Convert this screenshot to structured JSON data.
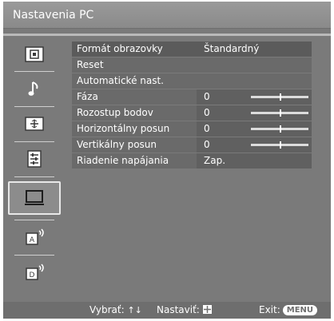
{
  "window": {
    "title": "Nastavenia PC"
  },
  "menu": {
    "rows": [
      {
        "label": "Formát obrazovky",
        "value": "Štandardný"
      },
      {
        "label": "Reset"
      },
      {
        "label": "Automatické nast."
      },
      {
        "label": "Fáza",
        "value": "0",
        "slider_level": 0.5
      },
      {
        "label": "Rozostup bodov",
        "value": "0",
        "slider_level": 0.5
      },
      {
        "label": "Horizontálny posun",
        "value": "0",
        "slider_level": 0.5
      },
      {
        "label": "Vertikálny posun",
        "value": "0",
        "slider_level": 0.5
      },
      {
        "label": "Riadenie napájania",
        "value": "Zap."
      }
    ]
  },
  "sidebar": {
    "items": [
      {
        "icon": "picture-icon"
      },
      {
        "icon": "music-note-icon"
      },
      {
        "icon": "screen-adjust-icon"
      },
      {
        "icon": "settings-list-icon"
      },
      {
        "icon": "pc-monitor-icon",
        "selected": true
      },
      {
        "icon": "input-a-icon"
      },
      {
        "icon": "input-d-icon"
      }
    ]
  },
  "footer": {
    "select_label": "Vybrať:",
    "select_arrows": "↑↓",
    "adjust_label": "Nastaviť:",
    "exit_label": "Exit:",
    "menu_button": "MENU"
  },
  "colors": {
    "background": "#7a7a7a",
    "row_label": "#6a6a6a",
    "row_value": "#606060",
    "text": "#ffffff"
  }
}
